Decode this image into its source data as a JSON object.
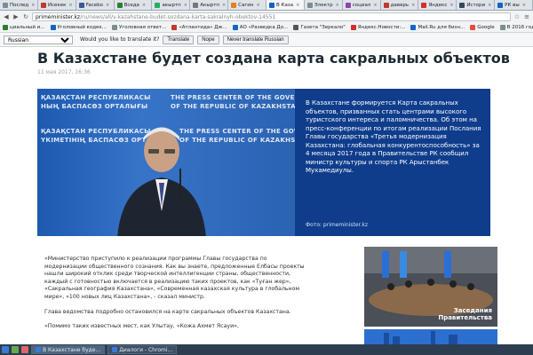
{
  "tabs": [
    {
      "label": "Послед",
      "color": "#7b8c9c"
    },
    {
      "label": "Исекек",
      "color": "#c0392b"
    },
    {
      "label": "Facebo",
      "color": "#3b5998"
    },
    {
      "label": "Вседа",
      "color": "#2e7d32"
    },
    {
      "label": "акыртп",
      "color": "#27ae60"
    },
    {
      "label": "Акыртп",
      "color": "#777"
    },
    {
      "label": "Сагин",
      "color": "#e67e22"
    },
    {
      "label": "В Каза",
      "color": "#1565c0",
      "active": true
    },
    {
      "label": "Электр",
      "color": "#7f8c8d"
    },
    {
      "label": "социал",
      "color": "#8e44ad"
    },
    {
      "label": "даверь",
      "color": "#c0392b"
    },
    {
      "label": "Яндекс",
      "color": "#d32f2f"
    },
    {
      "label": "Истори",
      "color": "#34495e"
    },
    {
      "label": "РК вы",
      "color": "#1565c0"
    }
  ],
  "address": {
    "domain": "primeminister.kz",
    "path": "/ru/news/all/v-kazahstane-budet-sozdana-karta-sakralnyh-obektov-14551"
  },
  "bookmarks": [
    {
      "label": "циальный и...",
      "color": "#2e7d32"
    },
    {
      "label": "Уголовный кодек...",
      "color": "#1565c0"
    },
    {
      "label": "Уголовная ответ...",
      "color": "#7f8c8d"
    },
    {
      "label": "«Атлантида» Дж...",
      "color": "#c0392b"
    },
    {
      "label": "АО «Разведка До...",
      "color": "#1565c0"
    },
    {
      "label": "Газета \"Зеркало\"",
      "color": "#555"
    },
    {
      "label": "Яндекс.Новости:...",
      "color": "#d32f2f"
    },
    {
      "label": "Mail.Ru для бизн...",
      "color": "#1565c0"
    },
    {
      "label": "Google",
      "color": "#e74c3c"
    },
    {
      "label": "В 2016 году и...",
      "color": "#7f8c8d"
    }
  ],
  "translate": {
    "language": "Russian",
    "question": "Would you like to translate it?",
    "translate_btn": "Translate",
    "nope_btn": "Nope",
    "never_btn": "Never translate Russian"
  },
  "article": {
    "title": "В Казахстане будет создана карта сакральных объектов",
    "date": "11 мая 2017, 16:36",
    "photo_texts": [
      "ҚАЗАҚСТАН РЕСПУБЛИКАСЫ",
      "THE PRESS CENTER OF THE GOVERNMENT",
      "НЫҢ БАСПАСӨЗ ОРТАЛЫҒЫ",
      "OF THE REPUBLIC OF KAZAKHSTAN",
      "ҚАЗАҚСТАН РЕСПУБЛИКАСЫ",
      "THE PRESS CENTER OF THE GOVERNMENT",
      "ҮКІМЕТІНІҢ БАСПАСӨЗ ОРТАЛЫҒЫ",
      "OF THE REPUBLIC OF KAZAKHSTAN"
    ],
    "lead": "В Казахстане формируется Карта сакральных объектов, призванных стать центрами высокого туристского интереса и паломничества. Об этом на пресс-конференции по итогам реализации Послания Главы государства «Третья модернизация Казахстана: глобальная конкурентоспособность» за 4 месяца 2017 года в Правительстве РК сообщил министр культуры и спорта РК Арыстанбек Мухамедиулы.",
    "photo_credit": "Фото: primeminister.kz",
    "para1": "«Министерство приступило к реализации программы Главы государства по модернизации общественного сознания. Как вы знаете, предложенные Елбасы проекты нашли широкий отклик среди творческой интеллигенции страны, общественности, каждый с готовностью включается в реализацию таких проектов, как «Туған жер», «Сакральная география Казахстана», «Современная казахская культура в глобальном мире», «100 новых лиц Казахстана», - сказал министр.",
    "para2": "Глава ведомства подробно остановился на карте сакральных объектов Казахстана.",
    "para3": "«Помимо таких известных мест, как Улытау, «Кожа Ахмет Ясауи»,"
  },
  "sidebar": {
    "card1_label_line1": "Заседания",
    "card1_label_line2": "Правительства"
  },
  "taskbar": {
    "items": [
      {
        "label": "В Казахстане буде...",
        "active": true
      },
      {
        "label": "Диалоги - Chromi...",
        "active": false
      }
    ]
  },
  "colors": {
    "hero_bg": "#0f3d8c",
    "taskbar": "#2c3e50"
  }
}
